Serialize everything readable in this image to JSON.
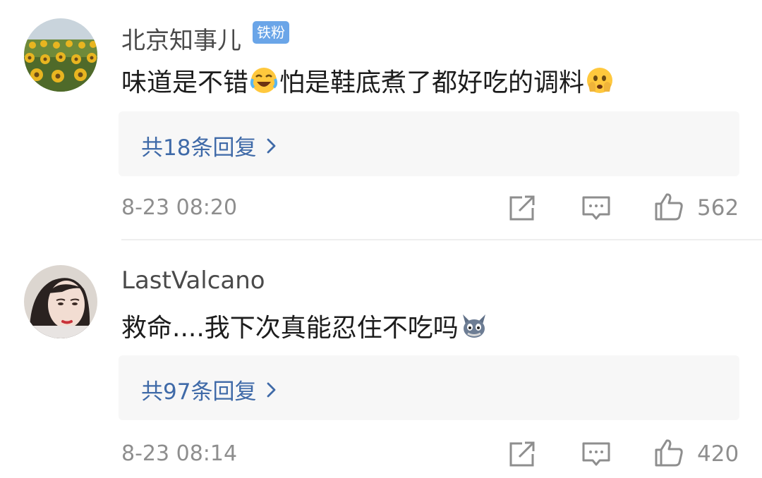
{
  "comments": [
    {
      "username": "北京知事儿",
      "badge": "铁粉",
      "text_part1": "味道是不错",
      "text_part2": " 怕是鞋底煮了都好吃的调料",
      "emoji1": "laughing-crying-emoji",
      "emoji2": "scared-face-emoji",
      "replies_label": "共18条回复",
      "time": "8-23 08:20",
      "likes": "562",
      "avatar": "sunflower-field-avatar"
    },
    {
      "username": "LastValcano",
      "text_part1": "救命....我下次真能忍住不吃吗",
      "emoji1": "tom-cat-emoji",
      "replies_label": "共97条回复",
      "time": "8-23 08:14",
      "likes": "420",
      "avatar": "woman-portrait-avatar"
    }
  ],
  "icons": {
    "share": "share-icon",
    "comment": "comment-icon",
    "like": "thumbs-up-icon",
    "chevron": "chevron-right-icon"
  },
  "colors": {
    "link": "#3f6aa8",
    "badge": "#6aa5e8",
    "meta": "#8e8e8e",
    "reply_bg": "#f7f7f7"
  }
}
